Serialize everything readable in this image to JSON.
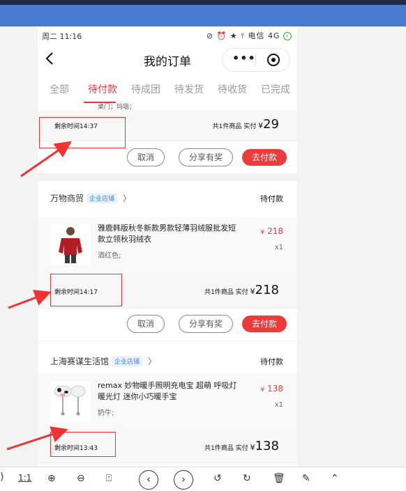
{
  "status_bar": {
    "time": "周二 11:16",
    "carrier": "电信",
    "network": "4G"
  },
  "nav": {
    "title": "我的订单"
  },
  "tabs": [
    {
      "label": "全部",
      "active": false
    },
    {
      "label": "待付款",
      "active": true
    },
    {
      "label": "待成团",
      "active": false
    },
    {
      "label": "待发货",
      "active": false
    },
    {
      "label": "待收货",
      "active": false
    },
    {
      "label": "已完成",
      "active": false
    }
  ],
  "orders": [
    {
      "partial_variant": "桌门；玛瑙；",
      "remaining": "剩余时间14:37",
      "summary_count": "共1件商品 实付",
      "currency": "¥",
      "total": "29",
      "btn_cancel": "取消",
      "btn_share": "分享有奖",
      "btn_pay": "去付款"
    },
    {
      "shop_name": "万物商贸",
      "shop_badge": "企业店铺",
      "status": "待付款",
      "product_name": "雅鹿韩版秋冬新款男款轻薄羽绒服批发短款立领秋羽绒衣",
      "variant": "酒红色;",
      "price_currency": "¥",
      "price": "218",
      "qty": "x1",
      "remaining": "剩余时间14:17",
      "summary_count": "共1件商品 实付",
      "currency": "¥",
      "total": "218",
      "btn_cancel": "取消",
      "btn_share": "分享有奖",
      "btn_pay": "去付款"
    },
    {
      "shop_name": "上海赛谋生活馆",
      "shop_badge": "企业店铺",
      "status": "待付款",
      "product_name": "remax 妙物暖手照明充电宝 超萌 呼吸灯 暖光灯 迷你小巧暖手宝",
      "variant": "奶牛;",
      "price_currency": "¥",
      "price": "138",
      "qty": "x1",
      "remaining": "剩余时间13:43",
      "summary_count": "共1件商品 实付",
      "currency": "¥",
      "total": "138"
    }
  ],
  "toolbar": {
    "ratio_label": "1:1"
  },
  "colors": {
    "accent_red": "#ec3b3b",
    "annotation_red": "#e33333",
    "top_blue": "#4a7bd3"
  }
}
